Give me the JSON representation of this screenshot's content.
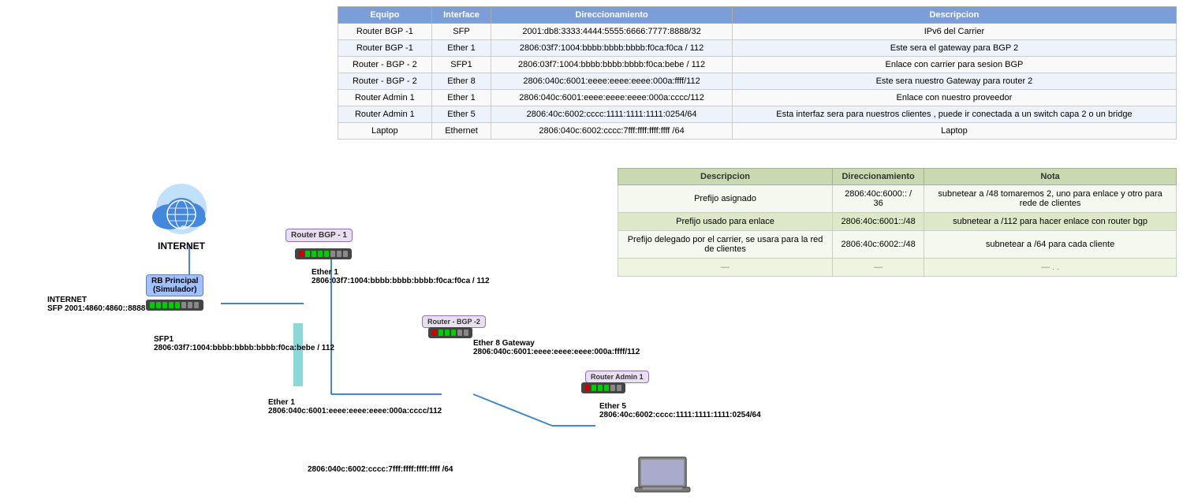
{
  "mainTable": {
    "headers": [
      "Equipo",
      "Interface",
      "Direccionamiento",
      "Descripcion"
    ],
    "rows": [
      {
        "equipo": "Router BGP -1",
        "interface": "SFP",
        "direccionamiento": "2001:db8:3333:4444:5555:6666:7777:8888/32",
        "descripcion": "IPv6 del Carrier"
      },
      {
        "equipo": "Router BGP -1",
        "interface": "Ether 1",
        "direccionamiento": "2806:03f7:1004:bbbb:bbbb:bbbb:f0ca:f0ca / 112",
        "descripcion": "Este sera el gateway para BGP 2"
      },
      {
        "equipo": "Router - BGP - 2",
        "interface": "SFP1",
        "direccionamiento": "2806:03f7:1004:bbbb:bbbb:bbbb:f0ca:bebe / 112",
        "descripcion": "Enlace con carrier para sesion BGP"
      },
      {
        "equipo": "Router - BGP - 2",
        "interface": "Ether 8",
        "direccionamiento": "2806:040c:6001:eeee:eeee:eeee:000a:ffff/112",
        "descripcion": "Este sera nuestro Gateway para router 2"
      },
      {
        "equipo": "Router Admin 1",
        "interface": "Ether 1",
        "direccionamiento": "2806:040c:6001:eeee:eeee:eeee:000a:cccc/112",
        "descripcion": "Enlace con nuestro proveedor"
      },
      {
        "equipo": "Router Admin 1",
        "interface": "Ether 5",
        "direccionamiento": "2806:40c:6002:cccc:1111:1111:1111:0254/64",
        "descripcion": "Esta interfaz sera para nuestros clientes , puede ir conectada a un switch capa 2 o un bridge"
      },
      {
        "equipo": "Laptop",
        "interface": "Ethernet",
        "direccionamiento": "2806:040c:6002:cccc:7fff:ffff:ffff:ffff /64",
        "descripcion": "Laptop"
      }
    ]
  },
  "secTable": {
    "headers": [
      "Descripcion",
      "Direccionamiento",
      "Nota"
    ],
    "rows": [
      {
        "descripcion": "Prefijo asignado",
        "direccionamiento": "2806:40c:6000:: / 36",
        "nota": "subnetear a /48  tomaremos 2, uno para enlace y otro para rede de clientes"
      },
      {
        "descripcion": "Prefijo usado para enlace",
        "direccionamiento": "2806:40c:6001::/48",
        "nota": "subnetear a /112 para hacer enlace con router bgp"
      },
      {
        "descripcion": "Prefijo delegado por el carrier, se usara para la red de clientes",
        "direccionamiento": "2806:40c:6002::/48",
        "nota": "subnetear a /64 para cada cliente"
      },
      {
        "descripcion": "—",
        "direccionamiento": "—",
        "nota": "— . ."
      }
    ]
  },
  "diagram": {
    "internet_label": "INTERNET",
    "rb_principal_label": "RB Principal\n(Simulador)",
    "router_bgp1_label": "Router BGP -\n1",
    "router_bgp2_label": "Router - BGP -2",
    "router_admin1_label": "Router Admin 1",
    "internet_sfp": "INTERNET\nSFP 2001:4860:4860::8888",
    "ether1_bgp1": "Ether 1\n2806:03f7:1004:bbbb:bbbb:bbbb:f0ca:f0ca / 112",
    "sfp1_bgp2": "SFP1\n2806:03f7:1004:bbbb:bbbb:bbbb:f0ca:bebe / 112",
    "ether8_gateway": "Ether 8 Gateway\n2806:040c:6001:eeee:eeee:eeee:000a:ffff/112",
    "ether1_admin": "Ether 1\n2806:040c:6001:eeee:eeee:eeee:000a:cccc/112",
    "ether5_admin": "Ether 5\n2806:40c:6002:cccc:1111:1111:1111:0254/64",
    "laptop_addr": "2806:040c:6002:cccc:7fff:ffff:ffff:ffff /64"
  }
}
